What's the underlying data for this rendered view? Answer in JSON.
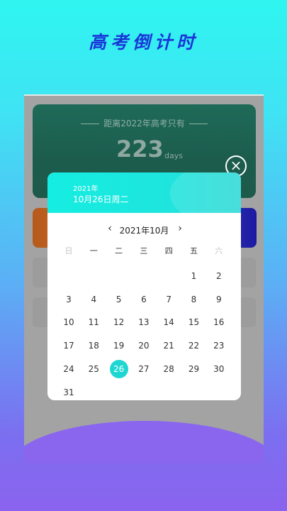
{
  "app": {
    "title": "高考倒计时"
  },
  "countdown": {
    "subtitle": "距离2022年高考只有",
    "days": "223",
    "unit": "days"
  },
  "dialog": {
    "year": "2021年",
    "date": "10月26日周二",
    "month_title": "2021年10月",
    "prev": "‹",
    "next": "›",
    "weekdays": [
      "日",
      "一",
      "二",
      "三",
      "四",
      "五",
      "六"
    ],
    "selected_day": "26",
    "days": [
      [
        "",
        "",
        "",
        "",
        "",
        "1",
        "2"
      ],
      [
        "3",
        "4",
        "5",
        "6",
        "7",
        "8",
        "9"
      ],
      [
        "10",
        "11",
        "12",
        "13",
        "14",
        "15",
        "16"
      ],
      [
        "17",
        "18",
        "19",
        "20",
        "21",
        "22",
        "23"
      ],
      [
        "24",
        "25",
        "26",
        "27",
        "28",
        "29",
        "30"
      ],
      [
        "31",
        "",
        "",
        "",
        "",
        "",
        ""
      ]
    ]
  },
  "colors": {
    "accent": "#1fd7d2",
    "title_blue": "#1a36d8"
  }
}
